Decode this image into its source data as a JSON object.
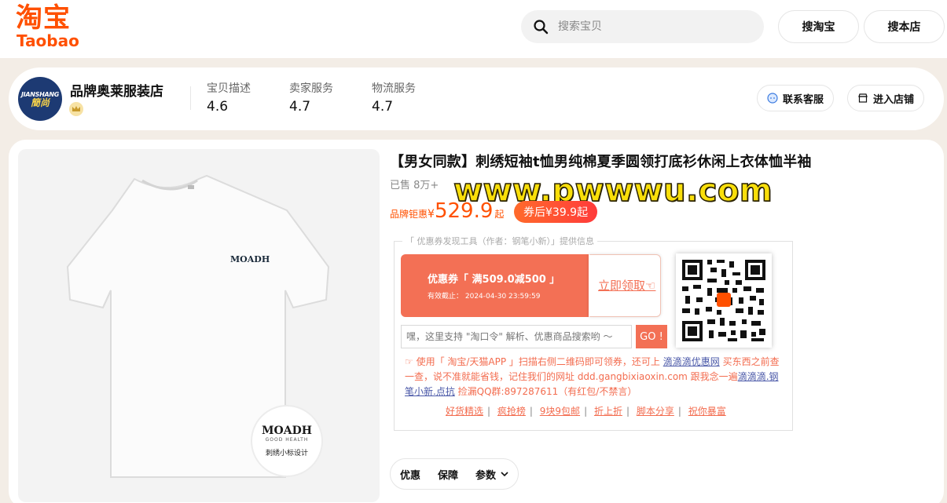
{
  "header": {
    "logo_cn": "淘宝",
    "logo_en": "Taobao",
    "search_placeholder": "搜索宝贝",
    "search_taobao": "搜淘宝",
    "search_store": "搜本店",
    "brand_color": "#ff5000"
  },
  "shop": {
    "avatar_line1": "JIANSHANG",
    "avatar_line2": "簡尚",
    "name": "品牌奥莱服装店",
    "scores": [
      {
        "label": "宝贝描述",
        "value": "4.6"
      },
      {
        "label": "卖家服务",
        "value": "4.7"
      },
      {
        "label": "物流服务",
        "value": "4.7"
      }
    ],
    "contact_label": "联系客服",
    "enter_label": "进入店铺"
  },
  "product": {
    "title": "【男女同款】刺绣短袖t恤男纯棉夏季圆领打底衫休闲上衣体恤半袖",
    "sold": "已售 8万+",
    "watermark": "www.pwwwu.com",
    "price_label": "品牌钜惠",
    "currency": "¥",
    "price": "529.9",
    "price_suffix": "起",
    "coupon_price": "券后¥39.9起",
    "logo_text": "MOADH",
    "badge_brand": "MOADH",
    "badge_sub": "GOOD HEALTH",
    "badge_caption": "刺绣小标设计"
  },
  "coupon_tool": {
    "caption": "「 优惠券发现工具（作者：钢笔小新）」提供信息",
    "ticket_title": "优惠券「 满509.0减500 」",
    "ticket_expiry": "有效截止： 2024-04-30 23:59:59",
    "claim_label": "立即领取☜",
    "input_placeholder": "嘿，这里支持 \"淘口令\" 解析、优惠商品搜索哟 ～",
    "go_label": "GO !",
    "notice_prefix": "☞ 使用「 淘宝/天猫APP 」扫描右侧二维码即可领券，还可上",
    "notice_link1": "滴滴滴优惠网",
    "notice_mid": "买东西之前查一查，说不准就能省钱，记住我们的网址 ddd.gangbixiaoxin.com 跟我念一遍",
    "notice_link2": "滴滴滴.钢笔小新.点抗",
    "notice_suffix": "捡漏QQ群:897287611（有红包/不禁言）",
    "links": [
      "好货精选",
      "疯抢榜",
      "9块9包邮",
      "折上折",
      "脚本分享",
      "祝你暴富"
    ]
  },
  "tabs": [
    "优惠",
    "保障",
    "参数"
  ]
}
